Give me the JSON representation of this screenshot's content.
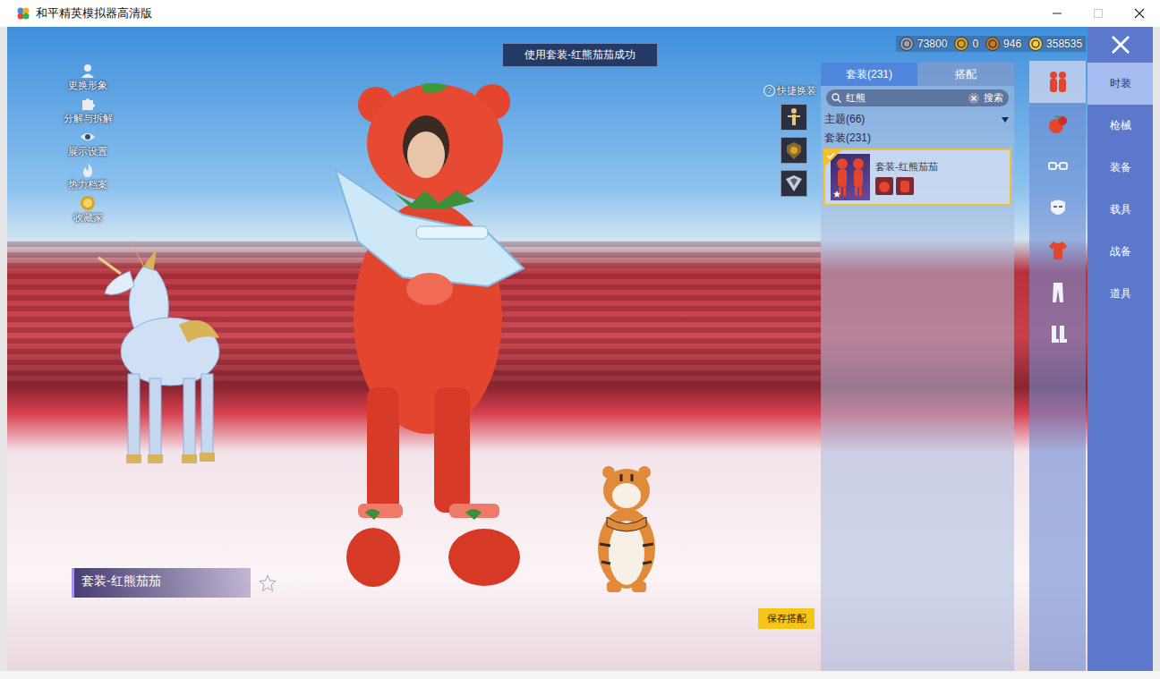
{
  "window": {
    "title": "和平精英模拟器高清版",
    "controls": [
      {
        "kind": "minimize",
        "disabled": false
      },
      {
        "kind": "maximize",
        "disabled": true
      },
      {
        "kind": "close",
        "disabled": false
      }
    ]
  },
  "toast": "使用套装-红熊茄茄成功",
  "currencies": [
    {
      "amount": "73800",
      "color": "#9aa3b5"
    },
    {
      "amount": "0",
      "color": "#d9a326"
    },
    {
      "amount": "946",
      "color": "#c07a2a"
    },
    {
      "amount": "358535",
      "color": "#f0cc48"
    }
  ],
  "left_menu": [
    {
      "label": "更换形象",
      "kind": "avatar"
    },
    {
      "label": "分解与拆解",
      "kind": "puzzle"
    },
    {
      "label": "展示设置",
      "kind": "eye"
    },
    {
      "label": "热力档案",
      "kind": "flame"
    },
    {
      "label": "收藏家",
      "kind": "medal"
    }
  ],
  "quick_switch": {
    "help": "?",
    "label": "快捷换装",
    "slots": [
      {
        "kind": "figure"
      },
      {
        "kind": "badge"
      },
      {
        "kind": "emblem"
      }
    ]
  },
  "panel": {
    "tabs": [
      {
        "label": "套装(231)",
        "selected": true
      },
      {
        "label": "搭配",
        "selected": false
      }
    ],
    "search": {
      "value": "红熊",
      "button": "搜索"
    },
    "groups": [
      {
        "label": "主题(66)",
        "expandable": true
      },
      {
        "label": "套装(231)",
        "expandable": false
      }
    ],
    "items": [
      {
        "name": "套装-红熊茄茄",
        "selected": true,
        "equipped": true,
        "favorite": true
      }
    ]
  },
  "categories": [
    {
      "kind": "outfit",
      "selected": true
    },
    {
      "kind": "hat",
      "selected": false
    },
    {
      "kind": "glasses",
      "selected": false
    },
    {
      "kind": "mask",
      "selected": false
    },
    {
      "kind": "top",
      "selected": false
    },
    {
      "kind": "pants",
      "selected": false
    },
    {
      "kind": "shoes",
      "selected": false
    }
  ],
  "nav": [
    {
      "label": "时装",
      "selected": true
    },
    {
      "label": "枪械",
      "selected": false
    },
    {
      "label": "装备",
      "selected": false
    },
    {
      "label": "载具",
      "selected": false
    },
    {
      "label": "战备",
      "selected": false
    },
    {
      "label": "道具",
      "selected": false
    }
  ],
  "nameplate": {
    "name": "套装-红熊茄茄",
    "favorite": false
  },
  "save_button": "保存搭配"
}
